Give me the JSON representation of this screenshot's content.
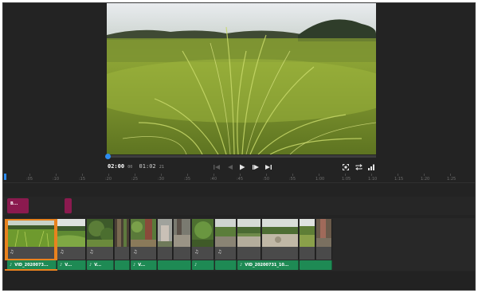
{
  "player": {
    "current_time": "02:00",
    "current_frames": "00",
    "duration": "01:02",
    "duration_frames": "21",
    "progress": 0.0
  },
  "ruler": {
    "labels": [
      ":05",
      ":10",
      ":15",
      ":20",
      ":25",
      ":30",
      ":35",
      ":40",
      ":45",
      ":50",
      ":55",
      "1:00",
      "1:05",
      "1:10",
      "1:15",
      "1:20",
      "1:25"
    ]
  },
  "titles": [
    {
      "label": "B..."
    },
    {
      "label": ""
    }
  ],
  "audio_clips": [
    {
      "label": "VID_2020073..."
    },
    {
      "label": "V..."
    },
    {
      "label": "V..."
    },
    {
      "label": "V..."
    },
    {
      "label": ""
    },
    {
      "label": ""
    },
    {
      "label": ""
    },
    {
      "label": "VID_20200731_10..."
    },
    {
      "label": ""
    },
    {
      "label": ""
    }
  ],
  "colors": {
    "accent": "#2d8cf0",
    "selection": "#e8821e",
    "title_clip": "#8b1a4f",
    "audio_clip": "#1e8a54"
  },
  "icons": [
    "skip-start-icon",
    "step-back-icon",
    "play-icon",
    "step-forward-icon",
    "skip-end-icon",
    "fullscreen-icon",
    "loop-icon",
    "quality-icon",
    "audio-wave-icon"
  ]
}
